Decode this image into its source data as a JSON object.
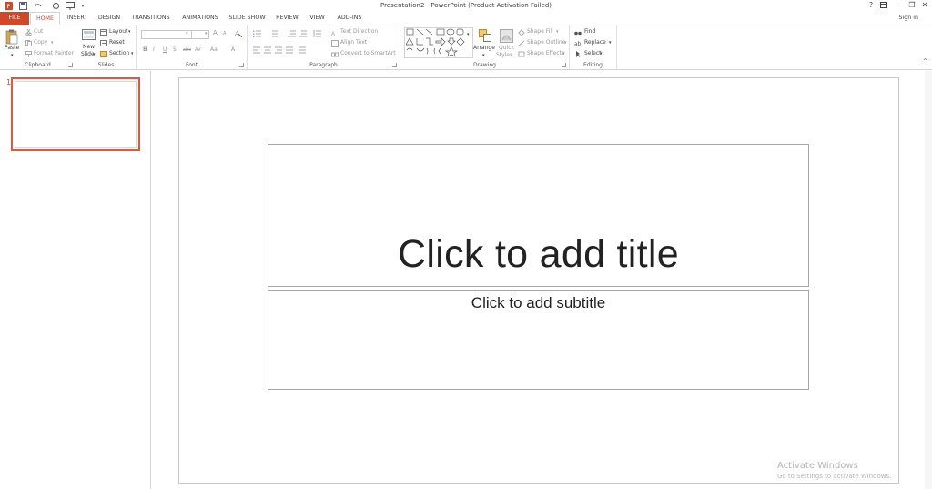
{
  "window": {
    "title": "Presentation2 - PowerPoint (Product Activation Failed)",
    "help": "?",
    "signin": "Sign in"
  },
  "tabs": [
    "FILE",
    "HOME",
    "INSERT",
    "DESIGN",
    "TRANSITIONS",
    "ANIMATIONS",
    "SLIDE SHOW",
    "REVIEW",
    "VIEW",
    "ADD-INS"
  ],
  "active_tab": "HOME",
  "ribbon": {
    "clipboard": {
      "label": "Clipboard",
      "paste": "Paste",
      "cut": "Cut",
      "copy": "Copy",
      "format_painter": "Format Painter"
    },
    "slides": {
      "label": "Slides",
      "new_slide": "New",
      "new_slide2": "Slide",
      "layout": "Layout",
      "reset": "Reset",
      "section": "Section"
    },
    "font": {
      "label": "Font",
      "bold": "B",
      "italic": "I",
      "underline": "U",
      "strike": "S",
      "spacing": "abc",
      "case": "Aa",
      "grow": "A",
      "shrink": "A",
      "color": "A"
    },
    "paragraph": {
      "label": "Paragraph",
      "text_direction": "Text Direction",
      "align_text": "Align Text",
      "convert_smartart": "Convert to SmartArt"
    },
    "drawing": {
      "label": "Drawing",
      "arrange": "Arrange",
      "quick_styles": "Quick",
      "quick_styles2": "Styles",
      "shape_fill": "Shape Fill",
      "shape_outline": "Shape Outline",
      "shape_effects": "Shape Effects"
    },
    "editing": {
      "label": "Editing",
      "find": "Find",
      "replace": "Replace",
      "select": "Select"
    }
  },
  "slides_pane": {
    "slide_number": "1"
  },
  "slide": {
    "title_placeholder": "Click to add title",
    "subtitle_placeholder": "Click to add subtitle"
  },
  "watermark": {
    "line1": "Activate Windows",
    "line2": "Go to Settings to activate Windows."
  },
  "colors": {
    "accent": "#d24726",
    "selection": "#e8563a"
  }
}
